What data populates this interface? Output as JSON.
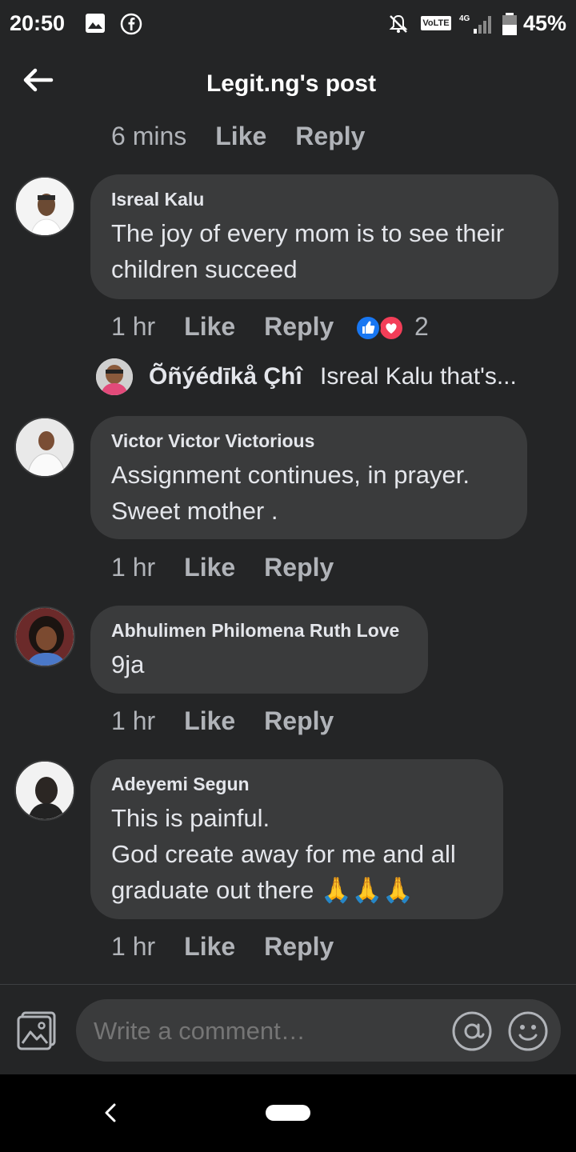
{
  "status": {
    "time": "20:50",
    "battery": "45%",
    "network": "VoLTE",
    "signal": "4G"
  },
  "header": {
    "title": "Legit.ng's post"
  },
  "prev_actions": {
    "time": "6 mins",
    "like": "Like",
    "reply": "Reply"
  },
  "comments": [
    {
      "author": "Isreal Kalu",
      "lines": [
        "The joy of every mom is to see their",
        "children succeed"
      ],
      "time": "1 hr",
      "like": "Like",
      "reply": "Reply",
      "reactions": {
        "icons": [
          "like-reaction",
          "love-reaction"
        ],
        "count": "2"
      },
      "reply_preview": {
        "author": "Õñýédīkå Çhî",
        "text": "Isreal Kalu that's..."
      }
    },
    {
      "author": "Victor Victor Victorious",
      "lines": [
        "Assignment continues, in prayer.",
        "Sweet mother ."
      ],
      "time": "1 hr",
      "like": "Like",
      "reply": "Reply"
    },
    {
      "author": "Abhulimen Philomena Ruth Love",
      "lines": [
        "9ja"
      ],
      "time": "1 hr",
      "like": "Like",
      "reply": "Reply"
    },
    {
      "author": "Adeyemi Segun",
      "lines": [
        "This is painful.",
        "God create away for me and all",
        "graduate out there 🙏🙏🙏"
      ],
      "time": "1 hr",
      "like": "Like",
      "reply": "Reply"
    }
  ],
  "composer": {
    "placeholder": "Write a comment…"
  },
  "colors": {
    "background": "#242526",
    "bubble": "#3a3b3c",
    "like_blue": "#1877f2",
    "love_red": "#f33e58"
  }
}
